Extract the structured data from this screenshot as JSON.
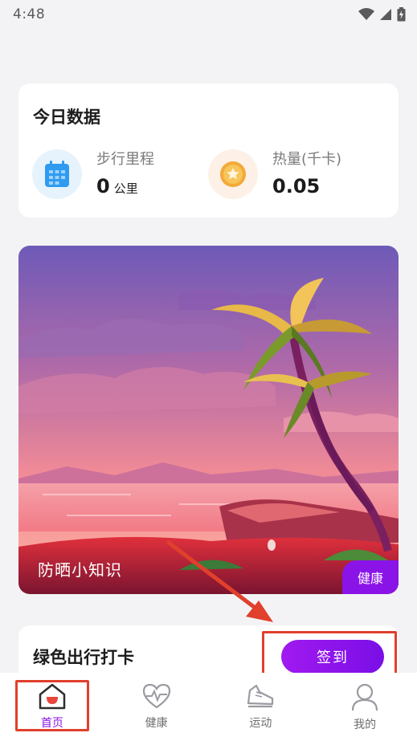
{
  "status_bar": {
    "time": "4:48"
  },
  "today": {
    "title": "今日数据",
    "distance": {
      "label": "步行里程",
      "value": "0",
      "unit": "公里",
      "icon": "calendar-icon"
    },
    "calorie": {
      "label": "热量(千卡)",
      "value": "0.05",
      "icon": "coin-icon"
    }
  },
  "banner": {
    "caption": "防晒小知识",
    "tag": "健康"
  },
  "checkin": {
    "title": "绿色出行打卡",
    "button_label": "签到"
  },
  "nav": [
    {
      "label": "首页",
      "icon": "home-icon",
      "active": true
    },
    {
      "label": "健康",
      "icon": "heart-pulse-icon",
      "active": false
    },
    {
      "label": "运动",
      "icon": "sneaker-icon",
      "active": false
    },
    {
      "label": "我的",
      "icon": "user-icon",
      "active": false
    }
  ],
  "colors": {
    "accent": "#8a14e8",
    "annotation": "#e0402c",
    "background": "#f3f3f5"
  }
}
